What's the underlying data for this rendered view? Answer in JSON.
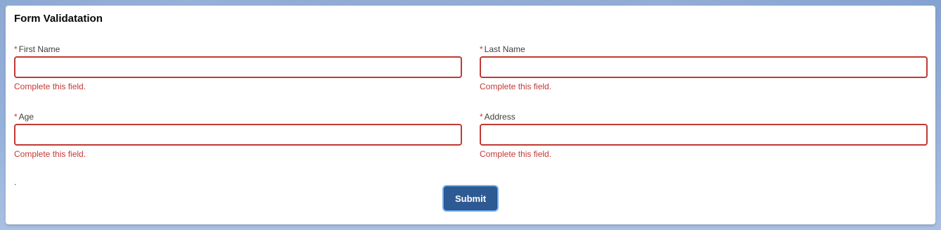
{
  "form": {
    "title": "Form Validatation",
    "required_marker": "*",
    "fields": [
      {
        "label": "First Name",
        "value": "",
        "error": "Complete this field."
      },
      {
        "label": "Last Name",
        "value": "",
        "error": "Complete this field."
      },
      {
        "label": "Age",
        "value": "",
        "error": "Complete this field."
      },
      {
        "label": "Address",
        "value": "",
        "error": "Complete this field."
      }
    ],
    "stray_text": ".",
    "submit_label": "Submit"
  },
  "colors": {
    "error": "#c23934",
    "button": "#2e5a94",
    "background": "#8aa9d6"
  }
}
